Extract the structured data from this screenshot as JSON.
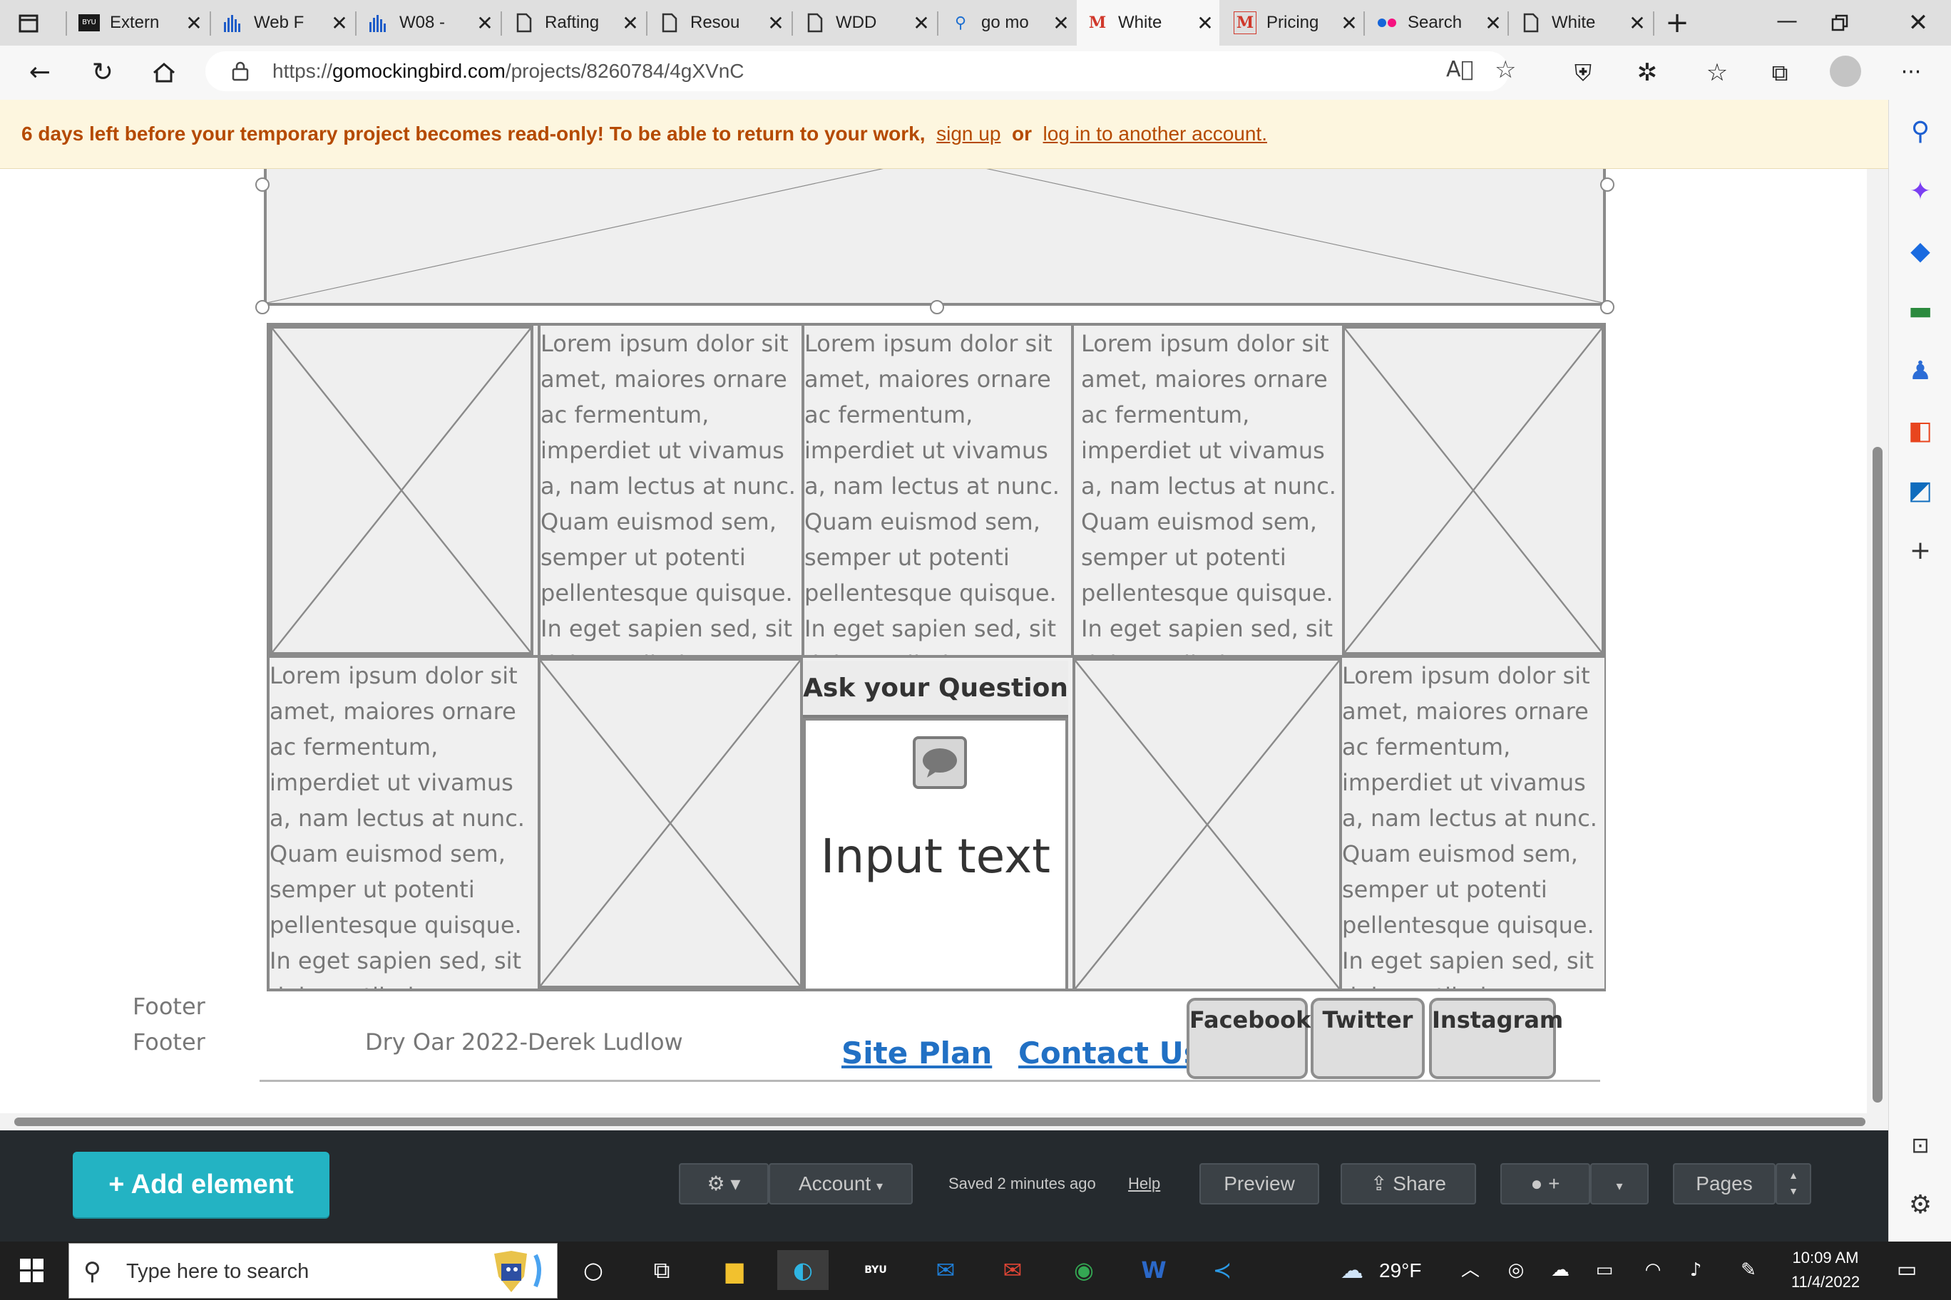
{
  "tabs": [
    {
      "title": "Extern",
      "icon": "byu-icon"
    },
    {
      "title": "Web F",
      "icon": "chart-icon"
    },
    {
      "title": "W08 -",
      "icon": "chart-icon"
    },
    {
      "title": "Rafting",
      "icon": "page-icon"
    },
    {
      "title": "Resou",
      "icon": "page-icon"
    },
    {
      "title": "WDD",
      "icon": "page-icon"
    },
    {
      "title": "go mo",
      "icon": "search-icon"
    },
    {
      "title": "White",
      "icon": "mockingbird-icon"
    },
    {
      "title": "Pricing",
      "icon": "mockingbird-icon"
    },
    {
      "title": "Search",
      "icon": "flickr-icon"
    },
    {
      "title": "White",
      "icon": "page-icon"
    }
  ],
  "address": {
    "prefix": "https://",
    "domain": "gomockingbird.com",
    "path": "/projects/8260784/4gXVnC"
  },
  "banner": {
    "message": "6 days left before your temporary project becomes read-only! To be able to return to your work,",
    "signup": "sign up",
    "or": "or",
    "login": "log in to another account."
  },
  "lorem": "Lorem ipsum dolor sit amet, maiores ornare ac fermentum, imperdiet ut vivamus a, nam lectus at nunc. Quam euismod sem, semper ut potenti pellentesque quisque. In eget sapien sed, sit duis vestibulum ultricies, placerat morbi amet vel",
  "ask": {
    "title": "Ask your Question",
    "input": "Input text"
  },
  "footer": {
    "label1": "Footer",
    "label2": "Footer",
    "copyright": "Dry Oar 2022-Derek Ludlow",
    "site_plan": "Site Plan",
    "contact": "Contact Us"
  },
  "social": {
    "facebook": "Facebook",
    "twitter": "Twitter",
    "instagram": "Instagram"
  },
  "toolbar": {
    "add": "+ Add element",
    "account": "Account",
    "saved": "Saved 2 minutes ago",
    "help": "Help",
    "preview": "Preview",
    "share": "Share",
    "comment": "+",
    "pages": "Pages"
  },
  "taskbar": {
    "search_placeholder": "Type here to search",
    "weather": "29°F",
    "time": "10:09 AM",
    "date": "11/4/2022"
  },
  "colors": {
    "banner_bg": "#fdf6df",
    "banner_text": "#b54a00",
    "add_button": "#23b3c3",
    "link": "#2170c4",
    "toolbar_bg": "#252a2e"
  }
}
